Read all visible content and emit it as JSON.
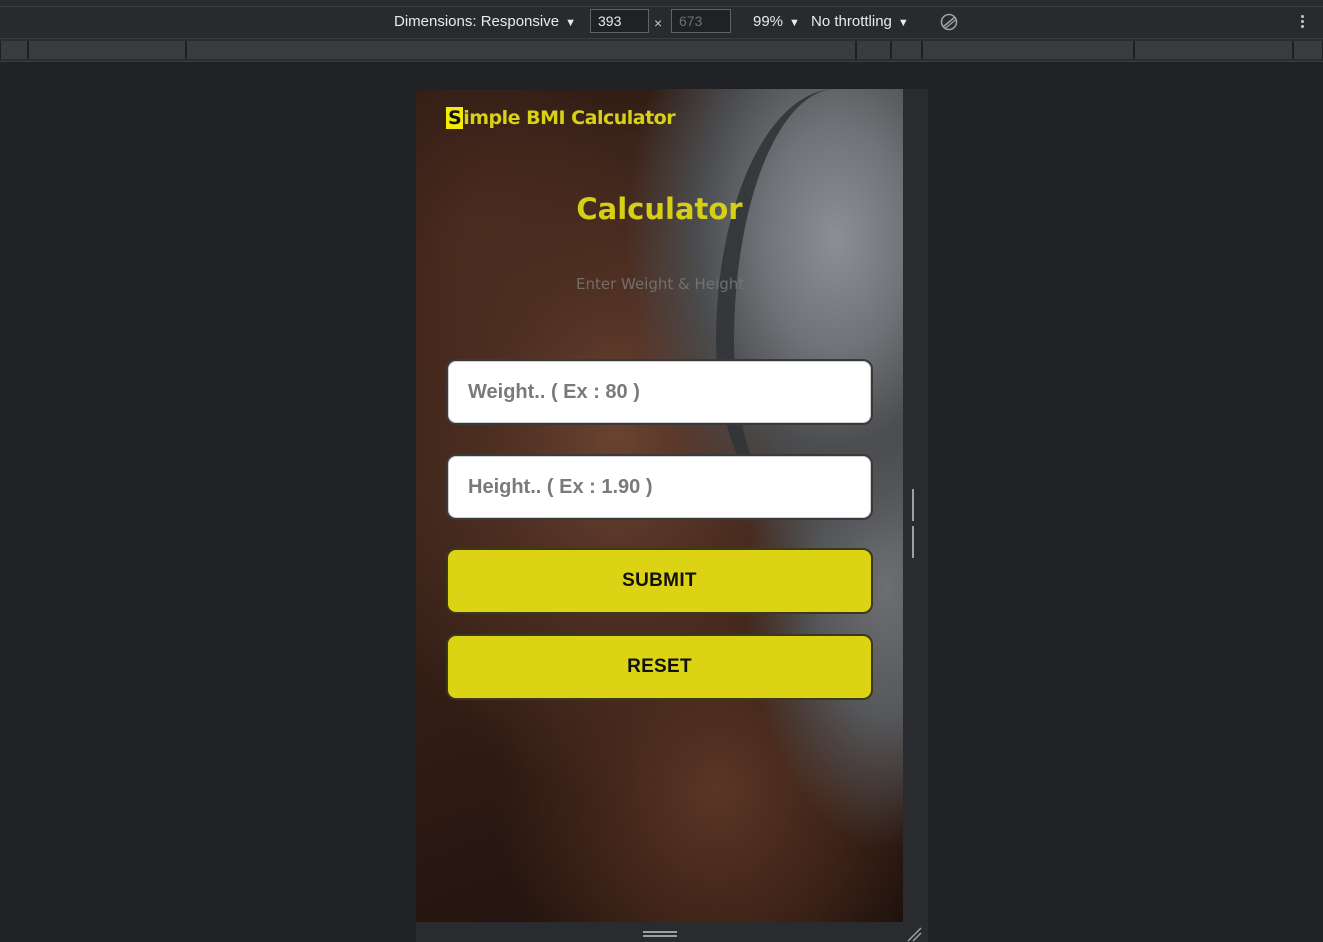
{
  "devtools": {
    "dimensions_label": "Dimensions: Responsive",
    "width_value": "393",
    "height_value": "673",
    "times": "×",
    "zoom": "99%",
    "throttling": "No throttling"
  },
  "app": {
    "brand_first_letter": "S",
    "brand_rest": "imple BMI Calculator",
    "title": "Calculator",
    "subtitle": "Enter Weight & Height",
    "weight_placeholder": "Weight.. ( Ex : 80 )",
    "height_placeholder": "Height.. ( Ex : 1.90 )",
    "submit_label": "SUBMIT",
    "reset_label": "RESET"
  },
  "colors": {
    "accent": "#ddd315",
    "brand_text": "#d8d216",
    "page_bg": "#202124"
  }
}
